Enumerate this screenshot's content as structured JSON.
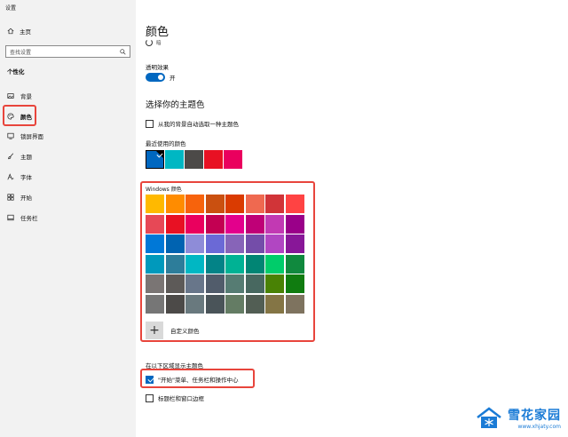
{
  "window": {
    "title": "设置"
  },
  "sidebar": {
    "home_label": "主页",
    "search_placeholder": "查找设置",
    "section_label": "个性化",
    "items": [
      {
        "label": "背景",
        "icon": "image-icon"
      },
      {
        "label": "颜色",
        "icon": "palette-icon",
        "active": true
      },
      {
        "label": "锁屏界面",
        "icon": "lockscreen-icon"
      },
      {
        "label": "主题",
        "icon": "brush-icon"
      },
      {
        "label": "字体",
        "icon": "font-icon"
      },
      {
        "label": "开始",
        "icon": "start-icon"
      },
      {
        "label": "任务栏",
        "icon": "taskbar-icon"
      }
    ]
  },
  "main": {
    "title": "颜色",
    "loading_text": "暗",
    "transparency": {
      "label": "透明效果",
      "state_label": "开",
      "on": true
    },
    "choose_heading": "选择你的主题色",
    "auto_pick_label": "从我的背景自动选取一种主题色",
    "recent_label": "最近使用的颜色",
    "recent_colors": [
      "#0067c0",
      "#00b7c3",
      "#4c4a48",
      "#e81123",
      "#ea005e"
    ],
    "windows_colors_label": "Windows 颜色",
    "windows_colors": [
      [
        "#ffb900",
        "#ff8c00",
        "#f7630c",
        "#ca5010",
        "#da3b01",
        "#ef6950",
        "#d13438",
        "#ff4343"
      ],
      [
        "#e74856",
        "#e81123",
        "#ea005e",
        "#c30052",
        "#e3008c",
        "#bf0077",
        "#c239b3",
        "#9a0089"
      ],
      [
        "#0078d7",
        "#0063b1",
        "#8e8cd8",
        "#6b69d6",
        "#8764b8",
        "#744da9",
        "#b146c2",
        "#881798"
      ],
      [
        "#0099bc",
        "#2d7d9a",
        "#00b7c3",
        "#038387",
        "#00b294",
        "#018574",
        "#00cc6a",
        "#10893e"
      ],
      [
        "#7a7574",
        "#5d5a58",
        "#68768a",
        "#515c6b",
        "#567c73",
        "#486860",
        "#498205",
        "#107c10"
      ],
      [
        "#767676",
        "#4c4a48",
        "#69797e",
        "#4a5459",
        "#647c64",
        "#525e54",
        "#847545",
        "#7e735f"
      ]
    ],
    "custom_color_label": "自定义颜色",
    "show_on_label": "在以下区域显示主题色",
    "start_taskbar_label": "\"开始\"菜单、任务栏和操作中心",
    "start_taskbar_checked": true,
    "titlebar_label": "标题栏和窗口边框",
    "titlebar_checked": false
  },
  "watermark": {
    "name": "雪花家园",
    "url": "www.xhjaty.com"
  }
}
